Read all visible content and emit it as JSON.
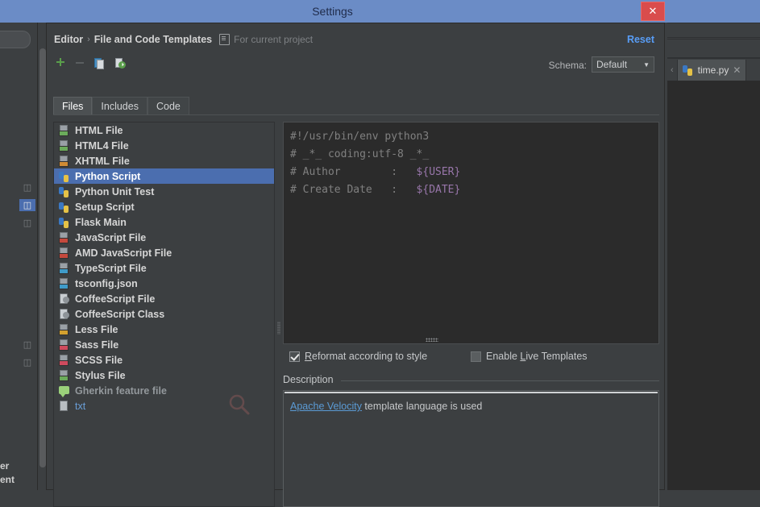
{
  "window": {
    "title": "Settings",
    "close_label": "✕"
  },
  "ide": {
    "tab_label": "time.py",
    "tab_close": "✕",
    "tab_chevron": "‹",
    "bottom_text_1": "er",
    "bottom_text_2": "ent"
  },
  "header": {
    "crumb_1": "Editor",
    "crumb_sep": "›",
    "crumb_2": "File and Code Templates",
    "scope_text": "For current project",
    "reset_label": "Reset"
  },
  "toolbar": {
    "add_label": "+",
    "remove_label": "−",
    "copy_icon": "copy-icon",
    "export_icon": "export-icon",
    "schema_label": "Schema:",
    "schema_value": "Default",
    "schema_caret": "▼"
  },
  "tabs": [
    {
      "label": "Files",
      "active": true
    },
    {
      "label": "Includes",
      "active": false
    },
    {
      "label": "Code",
      "active": false
    }
  ],
  "templates": [
    {
      "label": "HTML File",
      "icon": "html-file-icon",
      "badge": "#6bab5b",
      "kind": "page",
      "state": "normal"
    },
    {
      "label": "HTML4 File",
      "icon": "html4-file-icon",
      "badge": "#6bab5b",
      "kind": "page",
      "state": "normal"
    },
    {
      "label": "XHTML File",
      "icon": "xhtml-file-icon",
      "badge": "#cf8b34",
      "kind": "page",
      "state": "normal"
    },
    {
      "label": "Python Script",
      "icon": "python-file-icon",
      "badge": "",
      "kind": "python",
      "state": "selected"
    },
    {
      "label": "Python Unit Test",
      "icon": "python-file-icon",
      "badge": "",
      "kind": "python",
      "state": "normal"
    },
    {
      "label": "Setup Script",
      "icon": "python-file-icon",
      "badge": "",
      "kind": "python",
      "state": "normal"
    },
    {
      "label": "Flask Main",
      "icon": "python-file-icon",
      "badge": "",
      "kind": "python",
      "state": "normal"
    },
    {
      "label": "JavaScript File",
      "icon": "javascript-file-icon",
      "badge": "#c4493d",
      "kind": "page",
      "state": "normal"
    },
    {
      "label": "AMD JavaScript File",
      "icon": "amd-javascript-icon",
      "badge": "#c4493d",
      "kind": "page",
      "state": "normal"
    },
    {
      "label": "TypeScript File",
      "icon": "typescript-file-icon",
      "badge": "#3f9bc9",
      "kind": "page",
      "state": "normal"
    },
    {
      "label": "tsconfig.json",
      "icon": "tsconfig-json-icon",
      "badge": "#3f9bc9",
      "kind": "page",
      "state": "normal"
    },
    {
      "label": "CoffeeScript File",
      "icon": "coffeescript-icon",
      "badge": "",
      "kind": "coffee",
      "state": "normal"
    },
    {
      "label": "CoffeeScript Class",
      "icon": "coffeescript-icon",
      "badge": "",
      "kind": "coffee",
      "state": "normal"
    },
    {
      "label": "Less File",
      "icon": "less-file-icon",
      "badge": "#d3a12f",
      "kind": "page",
      "state": "normal"
    },
    {
      "label": "Sass File",
      "icon": "sass-file-icon",
      "badge": "#cf4b5e",
      "kind": "page",
      "state": "normal"
    },
    {
      "label": "SCSS File",
      "icon": "scss-file-icon",
      "badge": "#cf4b5e",
      "kind": "page",
      "state": "normal"
    },
    {
      "label": "Stylus File",
      "icon": "stylus-file-icon",
      "badge": "#6bab5b",
      "kind": "page",
      "state": "normal"
    },
    {
      "label": "Gherkin feature file",
      "icon": "gherkin-feature-icon",
      "badge": "",
      "kind": "bubble",
      "state": "muted"
    },
    {
      "label": "txt",
      "icon": "txt-file-icon",
      "badge": "",
      "kind": "txt",
      "state": "link"
    }
  ],
  "editor": {
    "lines": [
      {
        "text": "#!/usr/bin/env python3",
        "var": ""
      },
      {
        "text": "# _*_ coding:utf-8 _*_",
        "var": ""
      },
      {
        "text": "# Author        :   ",
        "var": "${USER}"
      },
      {
        "text": "# Create Date   :   ",
        "var": "${DATE}"
      }
    ]
  },
  "options": {
    "reformat_label_pre": "R",
    "reformat_label_post": "eformat according to style",
    "reformat_checked": true,
    "live_templates_label_pre": "Enable ",
    "live_templates_label_mid": "L",
    "live_templates_label_post": "ive Templates",
    "live_templates_checked": false
  },
  "description": {
    "group_label": "Description",
    "link_text": "Apache Velocity",
    "body_text": " template language is used"
  },
  "colors": {
    "titlebar": "#6b8cc6",
    "accent_selection": "#4b6eaf",
    "link": "#589df6",
    "close_button": "#d94c4c",
    "dialog_bg": "#3c3f41",
    "editor_bg": "#2b2b2b"
  }
}
